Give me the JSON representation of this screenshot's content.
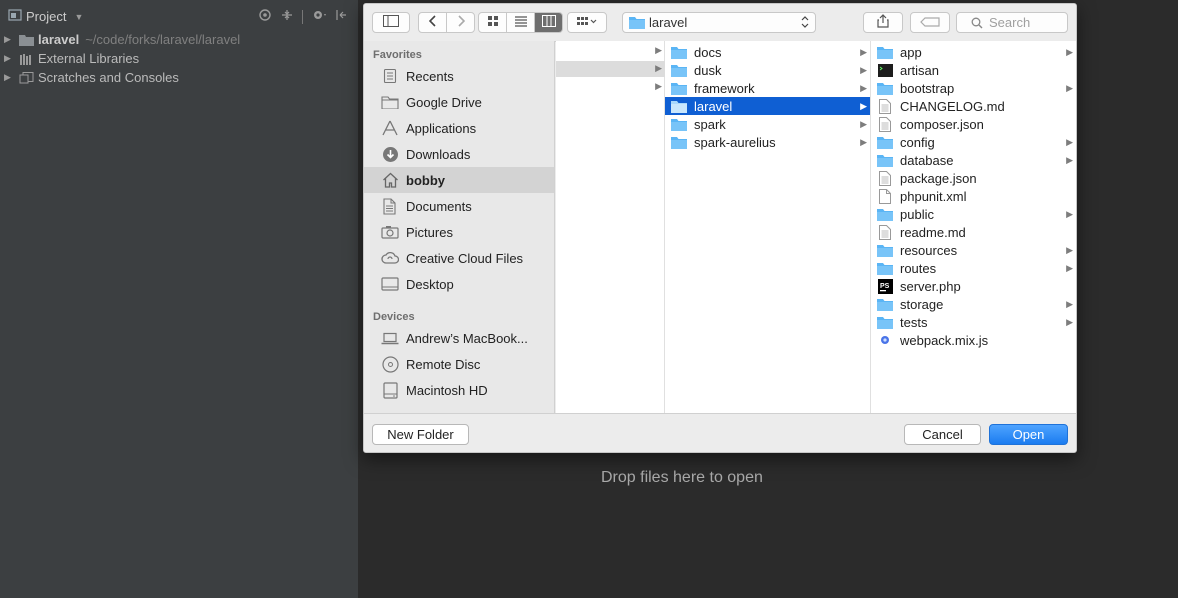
{
  "ide": {
    "panel_title": "Project",
    "tree": [
      {
        "label": "laravel",
        "path": "~/code/forks/laravel/laravel"
      },
      {
        "label": "External Libraries"
      },
      {
        "label": "Scratches and Consoles"
      }
    ],
    "drop_text": "Drop files here to open"
  },
  "dialog": {
    "location": "laravel",
    "search_placeholder": "Search",
    "sidebar": {
      "favorites_heading": "Favorites",
      "favorites": [
        {
          "label": "Recents",
          "icon": "recents-icon"
        },
        {
          "label": "Google Drive",
          "icon": "folder-icon"
        },
        {
          "label": "Applications",
          "icon": "applications-icon"
        },
        {
          "label": "Downloads",
          "icon": "downloads-icon"
        },
        {
          "label": "bobby",
          "icon": "home-icon",
          "selected": true
        },
        {
          "label": "Documents",
          "icon": "documents-icon"
        },
        {
          "label": "Pictures",
          "icon": "camera-icon"
        },
        {
          "label": "Creative Cloud Files",
          "icon": "creative-cloud-icon"
        },
        {
          "label": "Desktop",
          "icon": "desktop-icon"
        }
      ],
      "devices_heading": "Devices",
      "devices": [
        {
          "label": "Andrew’s MacBook...",
          "icon": "laptop-icon"
        },
        {
          "label": "Remote Disc",
          "icon": "disc-icon"
        },
        {
          "label": "Macintosh HD",
          "icon": "harddrive-icon"
        }
      ]
    },
    "column2": [
      {
        "label": "docs",
        "type": "folder",
        "arrow": true
      },
      {
        "label": "dusk",
        "type": "folder",
        "arrow": true
      },
      {
        "label": "framework",
        "type": "folder",
        "arrow": true
      },
      {
        "label": "laravel",
        "type": "folder",
        "arrow": true,
        "selected": true
      },
      {
        "label": "spark",
        "type": "folder",
        "arrow": true
      },
      {
        "label": "spark-aurelius",
        "type": "folder",
        "arrow": true
      }
    ],
    "column3": [
      {
        "label": "app",
        "type": "folder",
        "arrow": true
      },
      {
        "label": "artisan",
        "type": "terminal",
        "arrow": false
      },
      {
        "label": "bootstrap",
        "type": "folder",
        "arrow": true
      },
      {
        "label": "CHANGELOG.md",
        "type": "doc",
        "arrow": false
      },
      {
        "label": "composer.json",
        "type": "doc",
        "arrow": false
      },
      {
        "label": "config",
        "type": "folder",
        "arrow": true
      },
      {
        "label": "database",
        "type": "folder",
        "arrow": true
      },
      {
        "label": "package.json",
        "type": "doc",
        "arrow": false
      },
      {
        "label": "phpunit.xml",
        "type": "blank",
        "arrow": false
      },
      {
        "label": "public",
        "type": "folder",
        "arrow": true
      },
      {
        "label": "readme.md",
        "type": "doc",
        "arrow": false
      },
      {
        "label": "resources",
        "type": "folder",
        "arrow": true
      },
      {
        "label": "routes",
        "type": "folder",
        "arrow": true
      },
      {
        "label": "server.php",
        "type": "phpstorm",
        "arrow": false
      },
      {
        "label": "storage",
        "type": "folder",
        "arrow": true
      },
      {
        "label": "tests",
        "type": "folder",
        "arrow": true
      },
      {
        "label": "webpack.mix.js",
        "type": "js",
        "arrow": false
      }
    ],
    "new_folder_label": "New Folder",
    "cancel_label": "Cancel",
    "open_label": "Open"
  },
  "colors": {
    "selection_blue": "#0f5fd3",
    "folder_blue": "#5ab5f5",
    "ide_panel": "#3c3f41",
    "ide_editor": "#2b2b2b"
  }
}
